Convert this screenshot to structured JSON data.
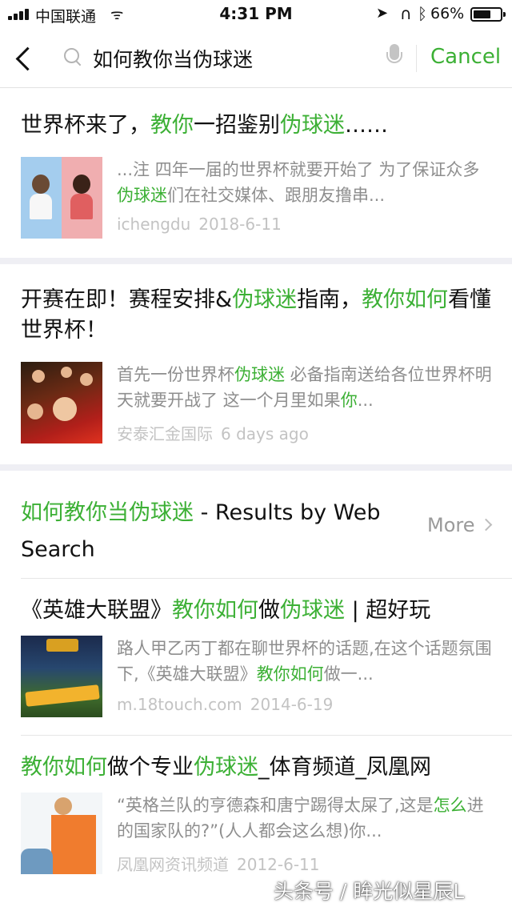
{
  "status_bar": {
    "carrier": "中国联通",
    "time": "4:31 PM",
    "battery_pct_text": "66%",
    "battery_level": 0.66,
    "icons": [
      "signal-icon",
      "wifi-icon",
      "location-arrow-icon",
      "headphones-icon",
      "bluetooth-icon",
      "battery-icon"
    ]
  },
  "search": {
    "query": "如何教你当伪球迷",
    "cancel_label": "Cancel"
  },
  "colors": {
    "accent": "#3cb035",
    "meta_gray": "#c3c3c3",
    "snippet_gray": "#8e8e8e"
  },
  "articles": [
    {
      "title": [
        {
          "t": "世界杯来了，",
          "hl": false
        },
        {
          "t": "教你",
          "hl": true
        },
        {
          "t": "一招鉴别",
          "hl": false
        },
        {
          "t": "伪球迷",
          "hl": true
        },
        {
          "t": "……",
          "hl": false
        }
      ],
      "snippet": [
        {
          "t": "...注 四年一届的世界杯就要开始了 为了保证众多",
          "hl": false
        },
        {
          "t": "伪球迷",
          "hl": true
        },
        {
          "t": "们在社交媒体、跟朋友撸串...",
          "hl": false
        }
      ],
      "source": "ichengdu",
      "date": "2018-6-11"
    },
    {
      "title": [
        {
          "t": "开赛在即！赛程安排&",
          "hl": false
        },
        {
          "t": "伪球迷",
          "hl": true
        },
        {
          "t": "指南，",
          "hl": false
        },
        {
          "t": "教你如何",
          "hl": true
        },
        {
          "t": "看懂世界杯！",
          "hl": false
        }
      ],
      "snippet": [
        {
          "t": "首先一份世界杯",
          "hl": false
        },
        {
          "t": "伪球迷",
          "hl": true
        },
        {
          "t": " 必备指南送给各位世界杯明天就要开战了 这一个月里如果",
          "hl": false
        },
        {
          "t": "你",
          "hl": true
        },
        {
          "t": "...",
          "hl": false
        }
      ],
      "source": "安泰汇金国际",
      "date": "6 days ago"
    }
  ],
  "web_search": {
    "header": [
      {
        "t": "如何教你当伪球迷",
        "hl": true
      },
      {
        "t": " - Results by Web Search",
        "hl": false
      }
    ],
    "more_label": "More",
    "results": [
      {
        "title": [
          {
            "t": "《英雄大联盟》",
            "hl": false
          },
          {
            "t": "教你如何",
            "hl": true
          },
          {
            "t": "做",
            "hl": false
          },
          {
            "t": "伪球迷",
            "hl": true
          },
          {
            "t": " | 超好玩",
            "hl": false
          }
        ],
        "snippet": [
          {
            "t": "路人甲乙丙丁都在聊世界杯的话题,在这个话题氛围下,《英雄大联盟》",
            "hl": false
          },
          {
            "t": "教你如何",
            "hl": true
          },
          {
            "t": "做一...",
            "hl": false
          }
        ],
        "source": "m.18touch.com",
        "date": "2014-6-19"
      },
      {
        "title": [
          {
            "t": "教你如何",
            "hl": true
          },
          {
            "t": "做个专业",
            "hl": false
          },
          {
            "t": "伪球迷",
            "hl": true
          },
          {
            "t": "_体育频道_凤凰网",
            "hl": false
          }
        ],
        "snippet": [
          {
            "t": "“英格兰队的亨德森和唐宁踢得太屎了,这是",
            "hl": false
          },
          {
            "t": "怎么",
            "hl": true
          },
          {
            "t": "进的国家队的?”(人人都会这么想)你...",
            "hl": false
          }
        ],
        "source": "凤凰网资讯频道",
        "date": "2012-6-11"
      }
    ]
  },
  "watermark": "头条号 / 眸光似星辰L"
}
